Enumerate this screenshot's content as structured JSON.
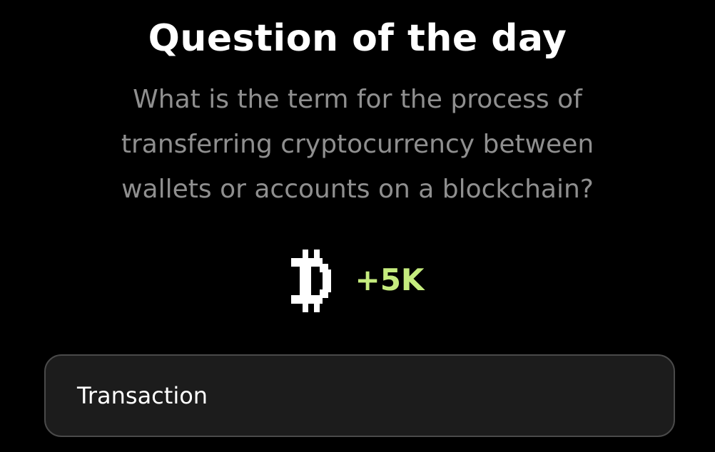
{
  "header": {
    "title": "Question of the day"
  },
  "question": {
    "text": "What is the term for the process of transferring cryptocurrency between wallets or accounts on a blockchain?"
  },
  "reward": {
    "icon": "pixel-coin-icon",
    "amount": "+5K",
    "accent_color": "#c5ec7e"
  },
  "answer": {
    "option_label": "Transaction"
  }
}
